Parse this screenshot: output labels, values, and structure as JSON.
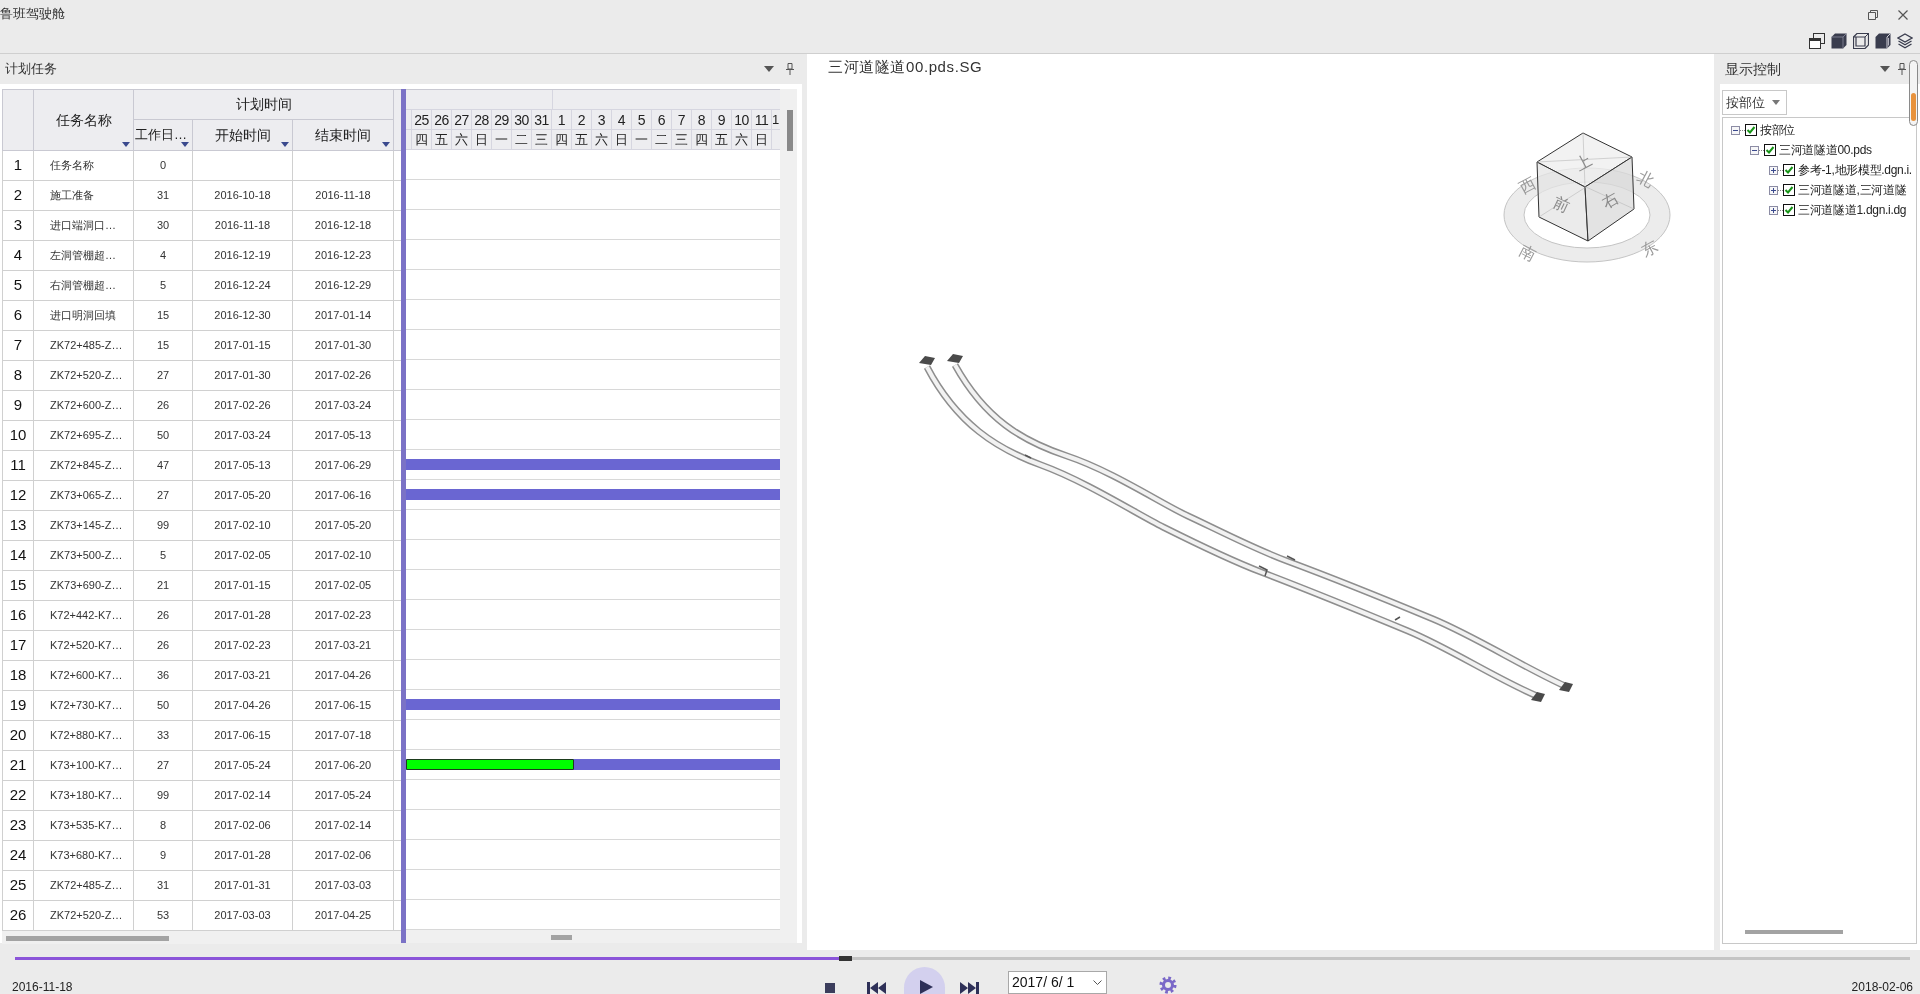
{
  "window": {
    "title": "鲁班驾驶舱"
  },
  "plan_panel": {
    "title": "计划任务",
    "table": {
      "name_column": "任务名称",
      "group_header": "计划时间",
      "columns": [
        "工作日…",
        "开始时间",
        "结束时间"
      ],
      "rows": [
        {
          "number": "1",
          "name": "任务名称",
          "workdays": "0"
        },
        {
          "number": "2",
          "name": "施工准备",
          "workdays": "31",
          "start": "2016-10-18",
          "end": "2016-11-18"
        },
        {
          "number": "3",
          "name": "进口端洞口…",
          "workdays": "30",
          "start": "2016-11-18",
          "end": "2016-12-18"
        },
        {
          "number": "4",
          "name": "左洞管棚超…",
          "workdays": "4",
          "start": "2016-12-19",
          "end": "2016-12-23"
        },
        {
          "number": "5",
          "name": "右洞管棚超…",
          "workdays": "5",
          "start": "2016-12-24",
          "end": "2016-12-29"
        },
        {
          "number": "6",
          "name": "进口明洞回填",
          "workdays": "15",
          "start": "2016-12-30",
          "end": "2017-01-14"
        },
        {
          "number": "7",
          "name": "ZK72+485-Z…",
          "workdays": "15",
          "start": "2017-01-15",
          "end": "2017-01-30"
        },
        {
          "number": "8",
          "name": "ZK72+520-Z…",
          "workdays": "27",
          "start": "2017-01-30",
          "end": "2017-02-26"
        },
        {
          "number": "9",
          "name": "ZK72+600-Z…",
          "workdays": "26",
          "start": "2017-02-26",
          "end": "2017-03-24"
        },
        {
          "number": "10",
          "name": "ZK72+695-Z…",
          "workdays": "50",
          "start": "2017-03-24",
          "end": "2017-05-13"
        },
        {
          "number": "11",
          "name": "ZK72+845-Z…",
          "workdays": "47",
          "start": "2017-05-13",
          "end": "2017-06-29",
          "bar": {
            "kind": "planned"
          }
        },
        {
          "number": "12",
          "name": "ZK73+065-Z…",
          "workdays": "27",
          "start": "2017-05-20",
          "end": "2017-06-16",
          "bar": {
            "kind": "planned"
          }
        },
        {
          "number": "13",
          "name": "ZK73+145-Z…",
          "workdays": "99",
          "start": "2017-02-10",
          "end": "2017-05-20"
        },
        {
          "number": "14",
          "name": "ZK73+500-Z…",
          "workdays": "5",
          "start": "2017-02-05",
          "end": "2017-02-10"
        },
        {
          "number": "15",
          "name": "ZK73+690-Z…",
          "workdays": "21",
          "start": "2017-01-15",
          "end": "2017-02-05"
        },
        {
          "number": "16",
          "name": "K72+442-K7…",
          "workdays": "26",
          "start": "2017-01-28",
          "end": "2017-02-23"
        },
        {
          "number": "17",
          "name": "K72+520-K7…",
          "workdays": "26",
          "start": "2017-02-23",
          "end": "2017-03-21"
        },
        {
          "number": "18",
          "name": "K72+600-K7…",
          "workdays": "36",
          "start": "2017-03-21",
          "end": "2017-04-26"
        },
        {
          "number": "19",
          "name": "K72+730-K7…",
          "workdays": "50",
          "start": "2017-04-26",
          "end": "2017-06-15",
          "bar": {
            "kind": "planned"
          }
        },
        {
          "number": "20",
          "name": "K72+880-K7…",
          "workdays": "33",
          "start": "2017-06-15",
          "end": "2017-07-18"
        },
        {
          "number": "21",
          "name": "K73+100-K7…",
          "workdays": "27",
          "start": "2017-05-24",
          "end": "2017-06-20",
          "bar": {
            "kind": "in_progress",
            "level": 0.45
          }
        },
        {
          "number": "22",
          "name": "K73+180-K7…",
          "workdays": "99",
          "start": "2017-02-14",
          "end": "2017-05-24"
        },
        {
          "number": "23",
          "name": "K73+535-K7…",
          "workdays": "8",
          "start": "2017-02-06",
          "end": "2017-02-14"
        },
        {
          "number": "24",
          "name": "K73+680-K7…",
          "workdays": "9",
          "start": "2017-01-28",
          "end": "2017-02-06"
        },
        {
          "number": "25",
          "name": "ZK72+485-Z…",
          "workdays": "31",
          "start": "2017-01-31",
          "end": "2017-03-03"
        },
        {
          "number": "26",
          "name": "ZK72+520-Z…",
          "workdays": "53",
          "start": "2017-03-03",
          "end": "2017-04-25"
        }
      ]
    },
    "gantt": {
      "days": [
        {
          "kind": "full",
          "day": "25",
          "weekday": "四"
        },
        {
          "kind": "full",
          "day": "26",
          "weekday": "五"
        },
        {
          "kind": "full",
          "day": "27",
          "weekday": "六"
        },
        {
          "kind": "full",
          "day": "28",
          "weekday": "日"
        },
        {
          "kind": "full",
          "day": "29",
          "weekday": "一"
        },
        {
          "kind": "full",
          "day": "30",
          "weekday": "二"
        },
        {
          "kind": "full",
          "day": "31",
          "weekday": "三"
        },
        {
          "kind": "full",
          "day": "1",
          "weekday": "四"
        },
        {
          "kind": "full",
          "day": "2",
          "weekday": "五"
        },
        {
          "kind": "full",
          "day": "3",
          "weekday": "六"
        },
        {
          "kind": "full",
          "day": "4",
          "weekday": "日"
        },
        {
          "kind": "full",
          "day": "5",
          "weekday": "一"
        },
        {
          "kind": "full",
          "day": "6",
          "weekday": "二"
        },
        {
          "kind": "full",
          "day": "7",
          "weekday": "三"
        },
        {
          "kind": "full",
          "day": "8",
          "weekday": "四"
        },
        {
          "kind": "full",
          "day": "9",
          "weekday": "五"
        },
        {
          "kind": "full",
          "day": "10",
          "weekday": "六"
        },
        {
          "kind": "full",
          "day": "11",
          "weekday": "日"
        },
        {
          "kind": "cut",
          "day": "1"
        }
      ]
    }
  },
  "viewer": {
    "title": "三河道隧道00.pds.SG",
    "cube_faces": [
      {
        "kind": "top",
        "label": "上"
      },
      {
        "kind": "front",
        "label": "前"
      },
      {
        "kind": "right",
        "label": "右"
      }
    ],
    "compass": [
      {
        "kind": "west",
        "label": "西"
      },
      {
        "kind": "north",
        "label": "北"
      },
      {
        "kind": "south",
        "label": "南"
      },
      {
        "kind": "east",
        "label": "东"
      }
    ]
  },
  "display_panel": {
    "title": "显示控制",
    "grouping": {
      "value": "按部位"
    },
    "tree": [
      {
        "label": "按部位",
        "checked": true,
        "expanded": true,
        "children": [
          {
            "label": "三河道隧道00.pds",
            "checked": true,
            "expanded": true,
            "children": [
              {
                "label": "参考-1,地形模型.dgn.i.",
                "checked": true,
                "expanded": false
              },
              {
                "label": "三河道隧道,三河道隧",
                "checked": true,
                "expanded": false
              },
              {
                "label": "三河道隧道1.dgn.i.dg",
                "checked": true,
                "expanded": false
              }
            ]
          }
        ]
      }
    ]
  },
  "playback": {
    "start_date": "2016-11-18",
    "level": 0.435,
    "date": "2017/ 6/ 1",
    "end_date": "2018-02-06"
  }
}
